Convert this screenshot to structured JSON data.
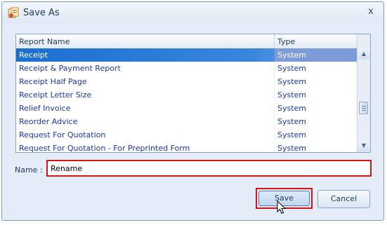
{
  "window": {
    "title": "Save As",
    "close_glyph": "x"
  },
  "grid": {
    "columns": [
      "Report Name",
      "Type"
    ],
    "rows": [
      {
        "name": "Receipt",
        "type": "System",
        "selected": true
      },
      {
        "name": "Receipt & Payment Report",
        "type": "System"
      },
      {
        "name": "Receipt Half Page",
        "type": "System"
      },
      {
        "name": "Receipt Letter Size",
        "type": "System"
      },
      {
        "name": "Relief Invoice",
        "type": "System"
      },
      {
        "name": "Reorder Advice",
        "type": "System"
      },
      {
        "name": "Request For Quotation",
        "type": "System"
      },
      {
        "name": "Request For Quotation - For Preprinted Form",
        "type": "System"
      }
    ]
  },
  "form": {
    "name_label": "Name :",
    "name_value": "Rename"
  },
  "buttons": {
    "save": "Save",
    "cancel": "Cancel"
  },
  "colors": {
    "highlight": "#d3151a",
    "selection": "#1a6fd1"
  }
}
